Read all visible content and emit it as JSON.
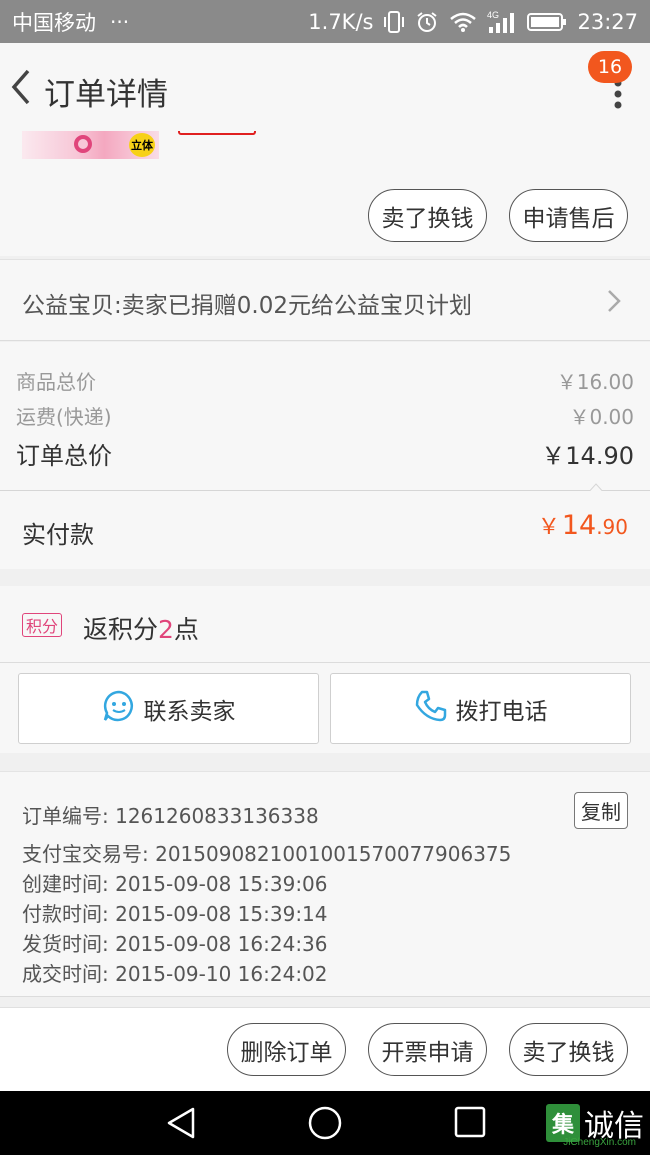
{
  "status_bar": {
    "carrier": "中国移动",
    "dots": "···",
    "speed": "1.7K/s",
    "network": "4G",
    "time": "23:27"
  },
  "header": {
    "title": "订单详情",
    "badge_count": "16"
  },
  "product": {
    "stamp": "立体",
    "buttons": {
      "sell": "卖了换钱",
      "after_sale": "申请售后"
    }
  },
  "charity": {
    "text": "公益宝贝:卖家已捐赠0.02元给公益宝贝计划"
  },
  "price": {
    "goods_label": "商品总价",
    "goods_value": "￥16.00",
    "shipping_label": "运费(快递)",
    "shipping_value": "￥0.00",
    "total_label": "订单总价",
    "total_value": "￥14.90"
  },
  "paid": {
    "label": "实付款",
    "currency": "￥",
    "integer": "14",
    "decimal": ".90"
  },
  "points": {
    "badge": "积分",
    "prefix": "返积分",
    "count": "2",
    "suffix": "点"
  },
  "contact": {
    "seller": "联系卖家",
    "call": "拨打电话"
  },
  "order_info": {
    "order_no": "订单编号: 1261260833136338",
    "alipay_no": "支付宝交易号: 2015090821001001570077906375",
    "created": "创建时间: 2015-09-08 15:39:06",
    "paid": "付款时间: 2015-09-08 15:39:14",
    "shipped": "发货时间: 2015-09-08 16:24:36",
    "completed": "成交时间: 2015-09-10 16:24:02",
    "copy": "复制"
  },
  "actions": {
    "delete": "删除订单",
    "invoice": "开票申请",
    "sell": "卖了换钱"
  },
  "watermark": {
    "mark": "集",
    "text": "诚信",
    "sub": "JiChengXin.com"
  },
  "colors": {
    "accent": "#f2571e",
    "points": "#e0457b",
    "statusbar": "#8a8a8a"
  }
}
